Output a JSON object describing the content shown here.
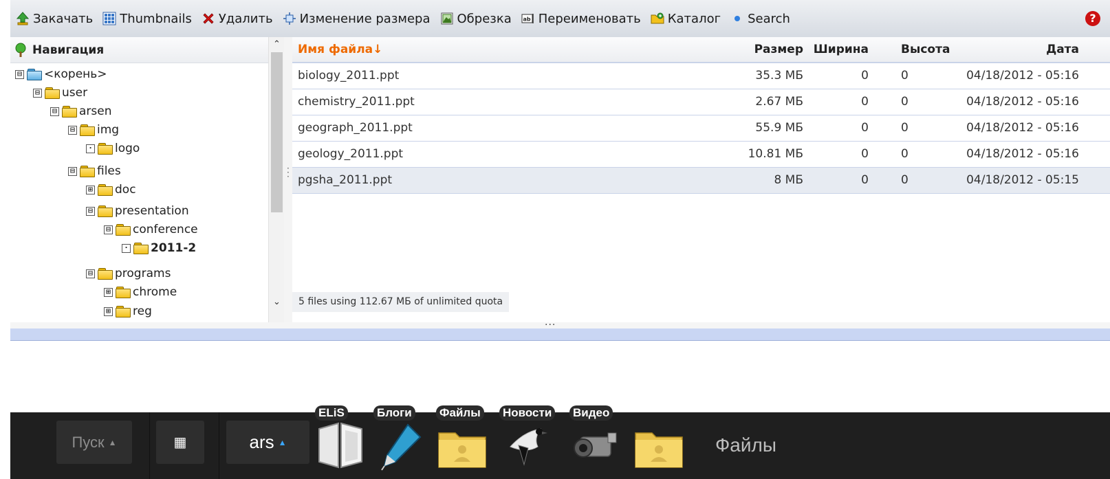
{
  "toolbar": {
    "items": [
      {
        "label": "Закачать",
        "icon": "upload-icon"
      },
      {
        "label": "Thumbnails",
        "icon": "thumbnails-icon"
      },
      {
        "label": "Удалить",
        "icon": "delete-icon"
      },
      {
        "label": "Изменение размера",
        "icon": "resize-icon"
      },
      {
        "label": "Обрезка",
        "icon": "crop-icon"
      },
      {
        "label": "Переименовать",
        "icon": "rename-icon"
      },
      {
        "label": "Каталог",
        "icon": "folder-catalog-icon"
      },
      {
        "label": "Search",
        "icon": "search-dot-icon"
      }
    ],
    "help_icon": "?"
  },
  "navigation": {
    "title": "Навигация",
    "tree": [
      {
        "label": "<корень>",
        "toggle": "⊟",
        "root": true
      },
      {
        "label": "user",
        "toggle": "⊟"
      },
      {
        "label": "arsen",
        "toggle": "⊟"
      },
      {
        "label": "img",
        "toggle": "⊟"
      },
      {
        "label": "logo",
        "toggle": "·"
      },
      {
        "label": "files",
        "toggle": "⊟"
      },
      {
        "label": "doc",
        "toggle": "⊞"
      },
      {
        "label": "presentation",
        "toggle": "⊟"
      },
      {
        "label": "conference",
        "toggle": "⊟"
      },
      {
        "label": "2011-2",
        "toggle": "·",
        "selected": true
      },
      {
        "label": "programs",
        "toggle": "⊟"
      },
      {
        "label": "chrome",
        "toggle": "⊞"
      },
      {
        "label": "reg",
        "toggle": "⊞"
      }
    ]
  },
  "file_list": {
    "columns": {
      "name": "Имя файла↓",
      "size": "Размер",
      "width": "Ширина",
      "height": "Высота",
      "date": "Дата"
    },
    "rows": [
      {
        "name": "biology_2011.ppt",
        "size": "35.3 МБ",
        "width": "0",
        "height": "0",
        "date": "04/18/2012 - 05:16"
      },
      {
        "name": "chemistry_2011.ppt",
        "size": "2.67 МБ",
        "width": "0",
        "height": "0",
        "date": "04/18/2012 - 05:16"
      },
      {
        "name": "geograph_2011.ppt",
        "size": "55.9 МБ",
        "width": "0",
        "height": "0",
        "date": "04/18/2012 - 05:16"
      },
      {
        "name": "geology_2011.ppt",
        "size": "10.81 МБ",
        "width": "0",
        "height": "0",
        "date": "04/18/2012 - 05:16"
      },
      {
        "name": "pgsha_2011.ppt",
        "size": "8 МБ",
        "width": "0",
        "height": "0",
        "date": "04/18/2012 - 05:15"
      }
    ],
    "status": "5 files using 112.67 МБ of unlimited quota"
  },
  "taskbar": {
    "start_label": "Пуск",
    "apps_glyph": "▦",
    "user_label": "ars",
    "launchers": [
      {
        "label": "ELiS",
        "icon": "book-icon"
      },
      {
        "label": "Блоги",
        "icon": "pen-icon"
      },
      {
        "label": "Файлы",
        "icon": "user-folder-icon"
      },
      {
        "label": "Новости",
        "icon": "magpie-icon"
      },
      {
        "label": "Видео",
        "icon": "camcorder-icon"
      }
    ],
    "active_window_title": "Файлы",
    "accent_color": "#3aa6ff"
  }
}
